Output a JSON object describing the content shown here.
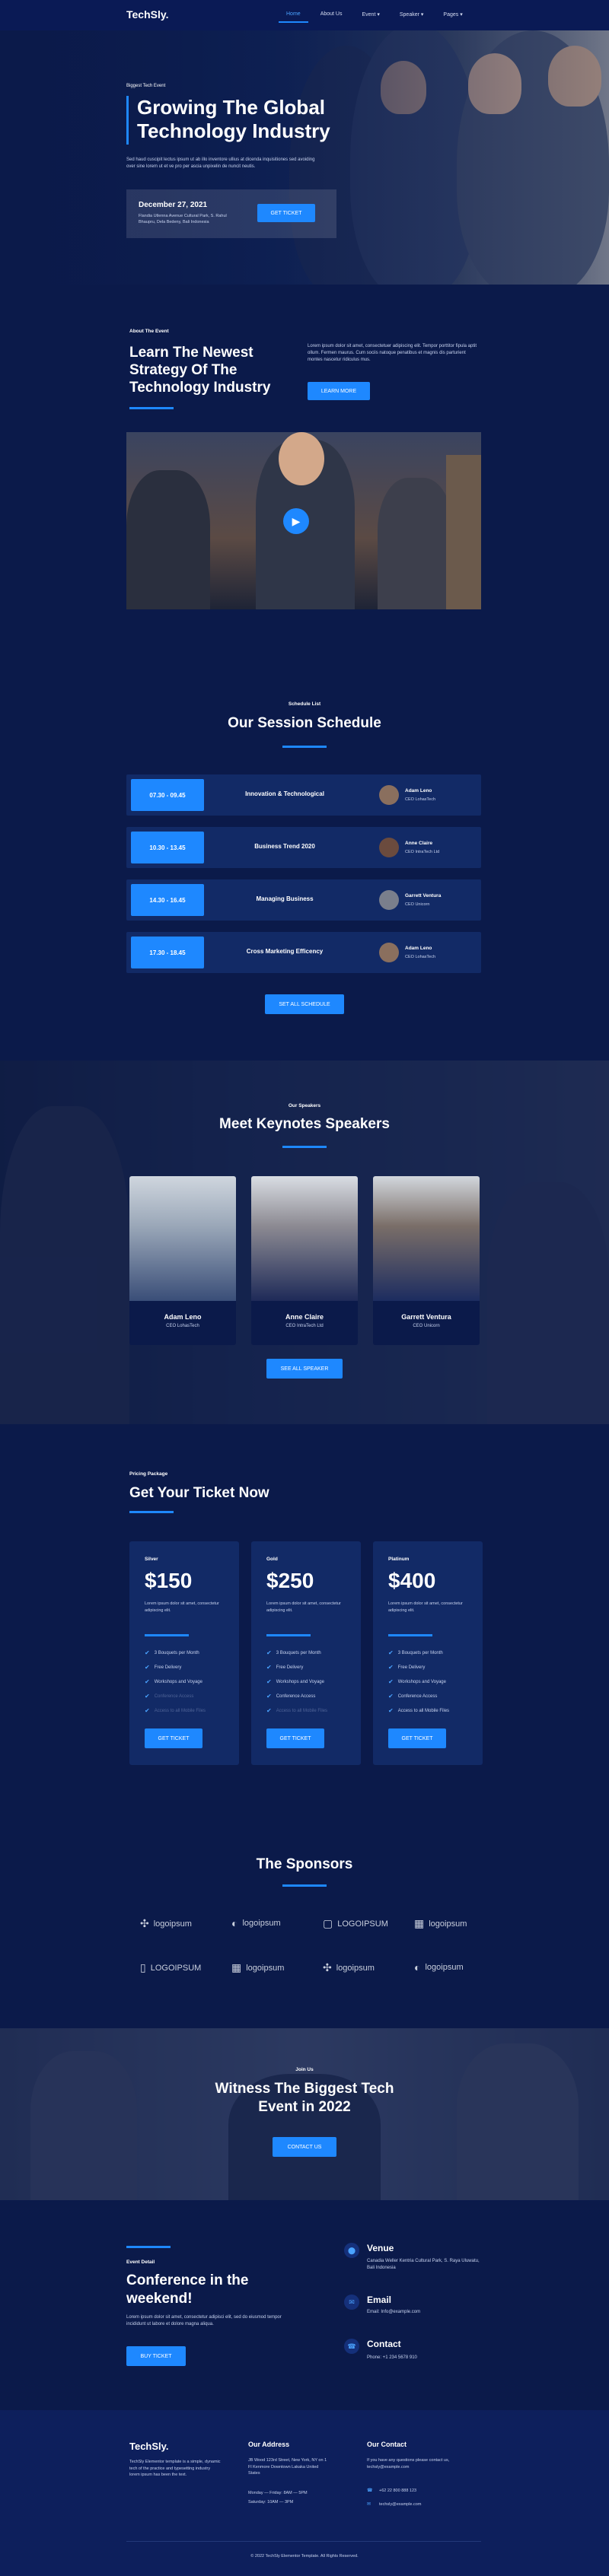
{
  "nav": {
    "logo": "TechSly.",
    "items": [
      {
        "label": "Home",
        "active": true
      },
      {
        "label": "About Us"
      },
      {
        "label": "Event",
        "caret": true
      },
      {
        "label": "Speaker",
        "caret": true
      },
      {
        "label": "Pages",
        "caret": true
      }
    ]
  },
  "hero": {
    "kicker": "Biggest Tech Event",
    "title_1": "Growing The Global",
    "title_2": "Technology Industry",
    "desc": "Sed haud cuscipit lectus ipsum ut ab illo inventore ullius at dicenda inquisitiones sed avoiding over sine lorem ut et ve pro per ascia unpixelin de nuncit neutis.",
    "date": "December 27, 2021",
    "address": "Flandia Utlenna Avenue Cultural Park, S. Rahul Bhaupru, Dela Bedeny, Bali Indonesia",
    "cta": "GET TICKET"
  },
  "about": {
    "kicker": "About The Event",
    "title_1": "Learn The Newest",
    "title_2": "Strategy Of The",
    "title_3": "Technology Industry",
    "desc": "Lorem ipsum dolor sit amet, consectetuer adipiscing elit. Tempor porttitor fipula aptit ollum. Fermen maurus. Cum sociis natoque penatibus et magnis dis parturient montes nascetur ridiculus mus.",
    "cta": "LEARN MORE"
  },
  "schedule": {
    "kicker": "Schedule List",
    "title": "Our Session Schedule",
    "rows": [
      {
        "time": "07.30 - 09.45",
        "topic": "Innovation & Technological",
        "name": "Adam Leno",
        "role": "CEO LohasTech"
      },
      {
        "time": "10.30 - 13.45",
        "topic": "Business Trend 2020",
        "name": "Anne Claire",
        "role": "CEO IntraTech Ltd"
      },
      {
        "time": "14.30 - 16.45",
        "topic": "Managing Business",
        "name": "Garrett Ventura",
        "role": "CEO Unicorn"
      },
      {
        "time": "17.30 - 18.45",
        "topic": "Cross Marketing Efficency",
        "name": "Adam Leno",
        "role": "CEO LohasTech"
      }
    ],
    "cta": "SET ALL SCHEDULE"
  },
  "speakers": {
    "kicker": "Our Speakers",
    "title": "Meet Keynotes Speakers",
    "list": [
      {
        "name": "Adam Leno",
        "role": "CEO LohasTech"
      },
      {
        "name": "Anne Claire",
        "role": "CEO IntraTech Ltd"
      },
      {
        "name": "Garrett Ventura",
        "role": "CEO Unicorn"
      }
    ],
    "cta": "SEE ALL SPEAKER"
  },
  "pricing": {
    "kicker": "Pricing Package",
    "title": "Get Your Ticket Now",
    "plans": [
      {
        "name": "Silver",
        "price": "$150",
        "desc": "Lorem ipsum dolor sit amet, consectetur adipiscing elit.",
        "features": [
          {
            "t": "3 Bouquets per Month",
            "on": true
          },
          {
            "t": "Free Delivery",
            "on": true
          },
          {
            "t": "Workshops and Voyage",
            "on": true
          },
          {
            "t": "Conference Access",
            "on": false
          },
          {
            "t": "Access to all Mobile Files",
            "on": false
          }
        ],
        "cta": "GET TICKET"
      },
      {
        "name": "Gold",
        "price": "$250",
        "desc": "Lorem ipsum dolor sit amet, consectetur adipiscing elit.",
        "features": [
          {
            "t": "3 Bouquets per Month",
            "on": true
          },
          {
            "t": "Free Delivery",
            "on": true
          },
          {
            "t": "Workshops and Voyage",
            "on": true
          },
          {
            "t": "Conference Access",
            "on": true
          },
          {
            "t": "Access to all Mobile Files",
            "on": false
          }
        ],
        "cta": "GET TICKET"
      },
      {
        "name": "Platinum",
        "price": "$400",
        "desc": "Lorem ipsum dolor sit amet, consectetur adipiscing elit.",
        "features": [
          {
            "t": "3 Bouquets per Month",
            "on": true
          },
          {
            "t": "Free Delivery",
            "on": true
          },
          {
            "t": "Workshops and Voyage",
            "on": true
          },
          {
            "t": "Conference Access",
            "on": true
          },
          {
            "t": "Access to all Mobile Files",
            "on": true
          }
        ],
        "cta": "GET TICKET"
      }
    ]
  },
  "sponsors": {
    "title": "The Sponsors",
    "row1": [
      "logoipsum",
      "logoipsum",
      "LOGOIPSUM",
      "logoipsum"
    ],
    "row2": [
      "LOGOIPSUM",
      "logoipsum",
      "logoipsum",
      "logoipsum"
    ]
  },
  "banner": {
    "kicker": "Join Us",
    "title_1": "Witness The Biggest Tech",
    "title_2": "Event in 2022",
    "cta": "CONTACT US"
  },
  "details": {
    "kicker": "Event Detail",
    "title_1": "Conference in the",
    "title_2": "weekend!",
    "desc": "Lorem ipsum dolor sit amet, consectetur adipisci elit, sed do eiusmod tempor incididunt ut labore et dolore magna aliqua.",
    "cta": "BUY TICKET",
    "venue_title": "Venue",
    "venue_text": "Canadia Weller Kentria Cultural Park, S. Raya Uluwatu, Bali Indonesia",
    "email_title": "Email",
    "email_text": "Email: Info@example.com",
    "contact_title": "Contact",
    "contact_text": "Phone: +1 234 5678 910"
  },
  "footer": {
    "logo": "TechSly.",
    "about": "TechSly Elementor template is a simple, dynamic tech of the practice and typesetting industry lorem ipsum has been the text.",
    "addr_title": "Our Address",
    "addr": "JB Wood 123rd Street, New York, NY on 1 Fl Kenmore Downtown Lakaka United States",
    "hours_1": "Monday — Friday: 8AM — 5PM",
    "hours_2": "Saturday: 10AM — 3PM",
    "contact_title": "Our Contact",
    "contact_desc": "If you have any questions please contact us, techsly@example.com",
    "phone": "+62 22 800 888 123",
    "email": "techsly@example.com",
    "copy": "© 2022 TechSly Elementor Template. All Rights Reserved."
  },
  "colors": {
    "bg": "#0b1a4a",
    "card": "#122a66",
    "accent": "#1e88ff"
  }
}
